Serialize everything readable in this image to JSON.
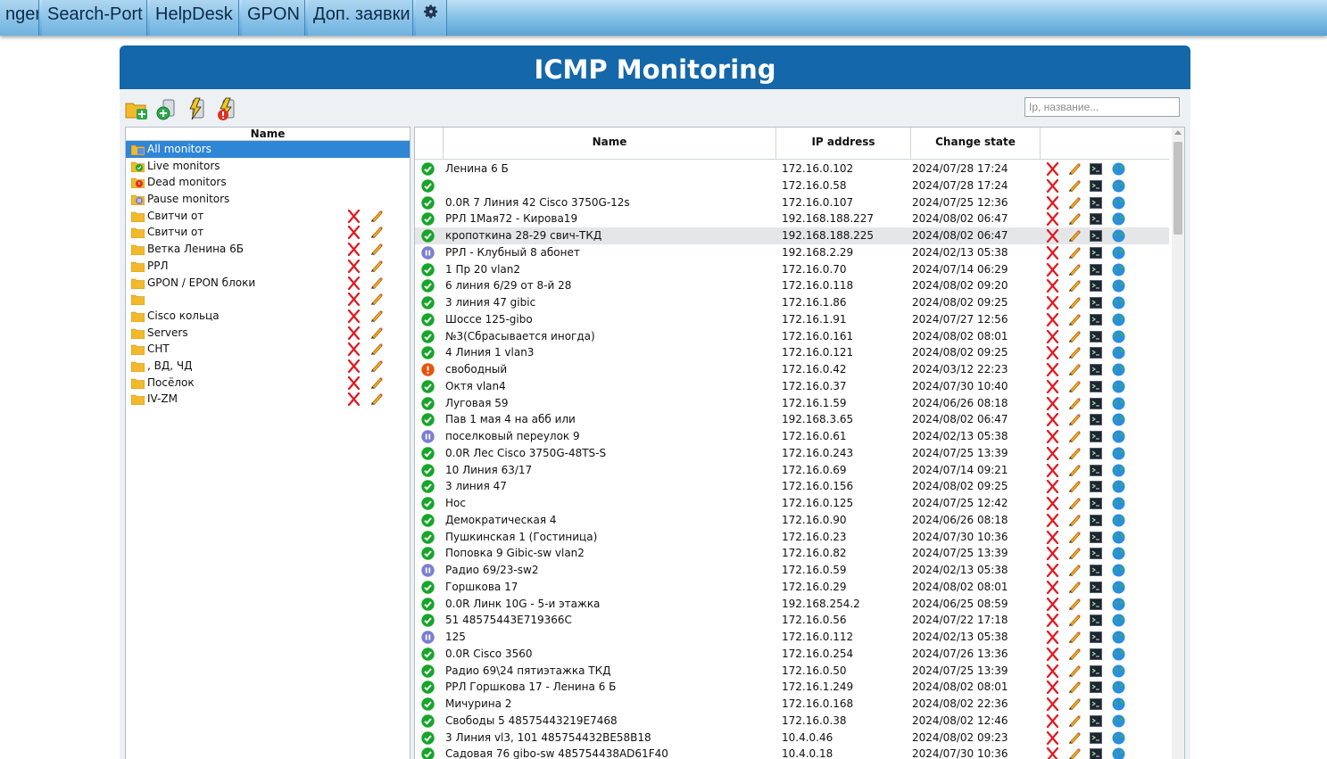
{
  "nav": {
    "items": [
      "nger",
      "Search-Port",
      "HelpDesk",
      "GPON",
      "Доп. заявки"
    ],
    "settings_icon": "gear-icon"
  },
  "panel": {
    "title": "ICMP Monitoring"
  },
  "search": {
    "placeholder": "Ip, название..."
  },
  "tree": {
    "header": "Name",
    "items": [
      {
        "label": "All monitors",
        "icon": "folder-all-icon",
        "selected": true,
        "actions": false
      },
      {
        "label": "Live monitors",
        "icon": "live-icon",
        "selected": false,
        "actions": false
      },
      {
        "label": "Dead monitors",
        "icon": "dead-icon",
        "selected": false,
        "actions": false
      },
      {
        "label": "Pause monitors",
        "icon": "pause-icon",
        "selected": false,
        "actions": false
      },
      {
        "label": "Свитчи от",
        "icon": "folder-icon",
        "selected": false,
        "actions": true
      },
      {
        "label": "Свитчи от",
        "icon": "folder-icon",
        "selected": false,
        "actions": true
      },
      {
        "label": "Ветка Ленина 6Б",
        "icon": "folder-icon",
        "selected": false,
        "actions": true
      },
      {
        "label": "РРЛ",
        "icon": "folder-icon",
        "selected": false,
        "actions": true
      },
      {
        "label": "GPON / EPON блоки",
        "icon": "folder-icon",
        "selected": false,
        "actions": true
      },
      {
        "label": "",
        "icon": "folder-icon",
        "selected": false,
        "actions": true
      },
      {
        "label": "Cisco кольца",
        "icon": "folder-icon",
        "selected": false,
        "actions": true
      },
      {
        "label": "Servers",
        "icon": "folder-icon",
        "selected": false,
        "actions": true
      },
      {
        "label": "СНТ",
        "icon": "folder-icon",
        "selected": false,
        "actions": true
      },
      {
        "label": ", ВД, ЧД",
        "icon": "folder-icon",
        "selected": false,
        "actions": true
      },
      {
        "label": "Посёлок",
        "icon": "folder-icon",
        "selected": false,
        "actions": true
      },
      {
        "label": "IV-ZM",
        "icon": "folder-icon",
        "selected": false,
        "actions": true
      }
    ]
  },
  "table": {
    "headers": {
      "name": "Name",
      "ip": "IP address",
      "change": "Change state"
    },
    "rows": [
      {
        "status": "up",
        "name": "Ленина 6 Б",
        "ip": "172.16.0.102",
        "date": "2024/07/28 17:24"
      },
      {
        "status": "up",
        "name": "",
        "ip": "172.16.0.58",
        "date": "2024/07/28 17:24"
      },
      {
        "status": "up",
        "name": "0.0R 7 Линия 42 Cisco 3750G-12s",
        "ip": "172.16.0.107",
        "date": "2024/07/25 12:36"
      },
      {
        "status": "up",
        "name": "РРЛ 1Мая72 - Кирова19",
        "ip": "192.168.188.227",
        "date": "2024/08/02 06:47"
      },
      {
        "status": "up",
        "name": "кропоткина 28-29 свич-ТКД",
        "ip": "192.168.188.225",
        "date": "2024/08/02 06:47",
        "highlight": true
      },
      {
        "status": "pause",
        "name": "РРЛ - Клубный 8 абонет",
        "ip": "192.168.2.29",
        "date": "2024/02/13 05:38"
      },
      {
        "status": "up",
        "name": "1 Пр 20 vlan2",
        "ip": "172.16.0.70",
        "date": "2024/07/14 06:29"
      },
      {
        "status": "up",
        "name": "6 линия 6/29 от 8-й 28",
        "ip": "172.16.0.118",
        "date": "2024/08/02 09:20"
      },
      {
        "status": "up",
        "name": "3 линия 47 gibic",
        "ip": "172.16.1.86",
        "date": "2024/08/02 09:25"
      },
      {
        "status": "up",
        "name": "Шоссе 125-gibo",
        "ip": "172.16.1.91",
        "date": "2024/07/27 12:56"
      },
      {
        "status": "up",
        "name": "№3(Сбрасывается иногда)",
        "ip": "172.16.0.161",
        "date": "2024/08/02 08:01"
      },
      {
        "status": "up",
        "name": "4 Линия 1 vlan3",
        "ip": "172.16.0.121",
        "date": "2024/08/02 09:25"
      },
      {
        "status": "down",
        "name": "свободный",
        "ip": "172.16.0.42",
        "date": "2024/03/12 22:23"
      },
      {
        "status": "up",
        "name": "Октя vlan4",
        "ip": "172.16.0.37",
        "date": "2024/07/30 10:40"
      },
      {
        "status": "up",
        "name": "Луговая 59",
        "ip": "172.16.1.59",
        "date": "2024/06/26 08:18"
      },
      {
        "status": "up",
        "name": "Пав 1 мая 4 на абб или",
        "ip": "192.168.3.65",
        "date": "2024/08/02 06:47"
      },
      {
        "status": "pause",
        "name": "поселковый переулок 9",
        "ip": "172.16.0.61",
        "date": "2024/02/13 05:38"
      },
      {
        "status": "up",
        "name": "0.0R Лес Cisco 3750G-48TS-S",
        "ip": "172.16.0.243",
        "date": "2024/07/25 13:39"
      },
      {
        "status": "up",
        "name": "10 Линия 63/17",
        "ip": "172.16.0.69",
        "date": "2024/07/14 09:21"
      },
      {
        "status": "up",
        "name": "3 линия 47",
        "ip": "172.16.0.156",
        "date": "2024/08/02 09:25"
      },
      {
        "status": "up",
        "name": "Нос",
        "ip": "172.16.0.125",
        "date": "2024/07/25 12:42"
      },
      {
        "status": "up",
        "name": "Демократическая 4",
        "ip": "172.16.0.90",
        "date": "2024/06/26 08:18"
      },
      {
        "status": "up",
        "name": "Пушкинская 1 (Гостиница)",
        "ip": "172.16.0.23",
        "date": "2024/07/30 10:36"
      },
      {
        "status": "up",
        "name": "Поповка 9 Gibic-sw vlan2",
        "ip": "172.16.0.82",
        "date": "2024/07/25 13:39"
      },
      {
        "status": "pause",
        "name": "Радио 69/23-sw2",
        "ip": "172.16.0.59",
        "date": "2024/02/13 05:38"
      },
      {
        "status": "up",
        "name": "Горшкова 17",
        "ip": "172.16.0.29",
        "date": "2024/08/02 08:01"
      },
      {
        "status": "up",
        "name": "0.0R Линк 10G - 5-и этажка",
        "ip": "192.168.254.2",
        "date": "2024/06/25 08:59"
      },
      {
        "status": "up",
        "name": "51 48575443E719366C",
        "ip": "172.16.0.56",
        "date": "2024/07/22 17:18"
      },
      {
        "status": "pause",
        "name": "125",
        "ip": "172.16.0.112",
        "date": "2024/02/13 05:38"
      },
      {
        "status": "up",
        "name": "0.0R Cisco 3560",
        "ip": "172.16.0.254",
        "date": "2024/07/26 13:36"
      },
      {
        "status": "up",
        "name": "Радио 69\\24 пятиэтажка ТКД",
        "ip": "172.16.0.50",
        "date": "2024/07/25 13:39"
      },
      {
        "status": "up",
        "name": "РРЛ Горшкова 17 - Ленина 6 Б",
        "ip": "172.16.1.249",
        "date": "2024/08/02 08:01"
      },
      {
        "status": "up",
        "name": "Мичурина 2",
        "ip": "172.16.0.168",
        "date": "2024/08/02 22:36"
      },
      {
        "status": "up",
        "name": "Свободы 5 48575443219E7468",
        "ip": "172.16.0.38",
        "date": "2024/08/02 12:46"
      },
      {
        "status": "up",
        "name": "3 Линия vl3, 101 485754432BE58B18",
        "ip": "10.4.0.46",
        "date": "2024/08/02 09:23"
      },
      {
        "status": "up",
        "name": "Садовая 76 gibo-sw 485754438AD61F40",
        "ip": "10.4.0.18",
        "date": "2024/07/30 10:36"
      }
    ]
  },
  "colors": {
    "header_blue": "#1467a9",
    "selected_blue": "#2f86d5",
    "status_up": "#17a52a",
    "status_down": "#e8540c",
    "status_pause": "#7a7fd0"
  }
}
